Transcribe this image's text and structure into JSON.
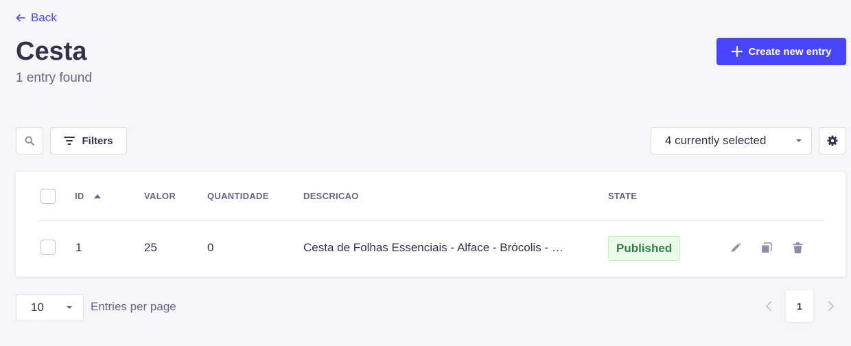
{
  "header": {
    "back_label": "Back",
    "title": "Cesta",
    "subtitle": "1 entry found",
    "create_label": "Create new entry"
  },
  "toolbar": {
    "filters_label": "Filters",
    "columns_select_value": "4 currently selected"
  },
  "table": {
    "columns": [
      "ID",
      "VALOR",
      "QUANTIDADE",
      "DESCRICAO",
      "STATE"
    ],
    "sorted_column": "ID",
    "rows": [
      {
        "id": "1",
        "valor": "25",
        "quantidade": "0",
        "descricao": "Cesta de Folhas Essenciais - Alface - Brócolis - …",
        "state": "Published"
      }
    ]
  },
  "pagination": {
    "per_page": "10",
    "per_page_label": "Entries per page",
    "current_page": "1"
  },
  "colors": {
    "accent": "#4945ff",
    "published_bg": "#eafbe7",
    "published_text": "#328048"
  }
}
